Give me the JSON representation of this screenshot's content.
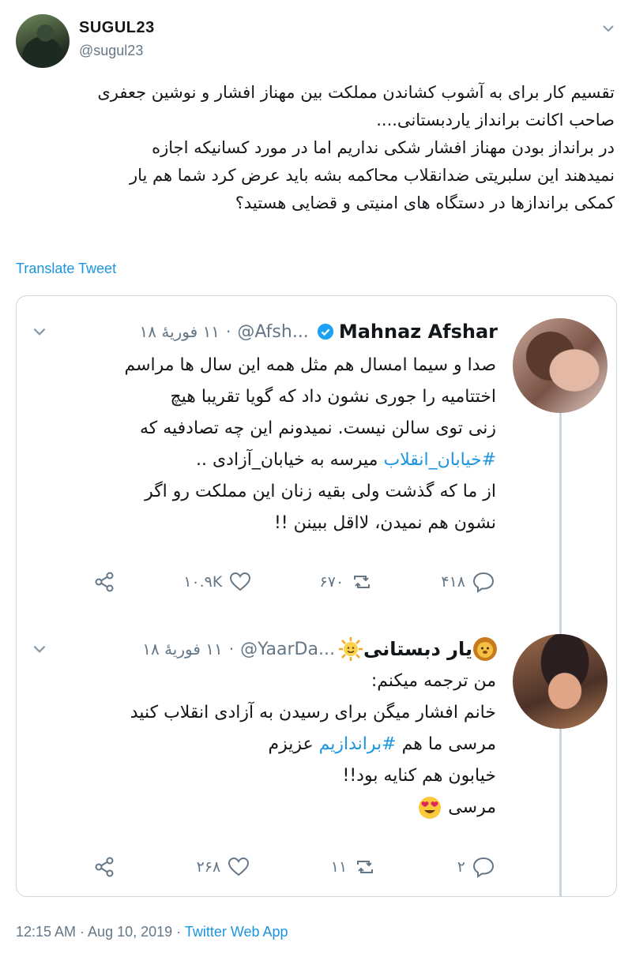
{
  "tweet": {
    "author_name": "SUGUL23",
    "author_handle": "@sugul23",
    "lines": [
      "تقسیم کار برای به آشوب کشاندن مملکت بین مهناز افشار و نوشین جعفری",
      "صاحب اکانت برانداز یاردبستانی....",
      "در برانداز بودن مهناز افشار شکی نداریم اما در مورد کسانیکه اجازه",
      "نمیدهند این سلبریتی ضدانقلاب محاکمه بشه باید عرض کرد شما هم یار",
      "کمکی براندازها در دستگاه های امنیتی و قضایی هستید؟"
    ],
    "translate_label": "Translate Tweet",
    "timestamp": "12:15 AM · Aug 10, 2019 ·",
    "source": "Twitter Web App"
  },
  "quoted": [
    {
      "name": "Mahnaz Afshar",
      "verified": true,
      "handle": "@Afsh...",
      "date": "۱۱ فوریهٔ ۱۸",
      "lines": [
        {
          "text": "صدا و سیما امسال هم مثل همه این سال ها مراسم"
        },
        {
          "text": "اختتامیه را جوری نشون داد که گویا تقریبا هیچ"
        },
        {
          "text": "زنی توی سالن نیست. نمیدونم این چه تصادفیه که"
        },
        {
          "hashtag": "#خیابان_انقلاب",
          "text": " میرسه به خیابان_آزادی .."
        },
        {
          "text": "از ما که گذشت ولی  بقیه زنان این مملکت رو اگر"
        },
        {
          "text": "نشون هم نمیدن، لااقل ببینن !!"
        }
      ],
      "replies": "۴۱۸",
      "retweets": "۶۷۰",
      "likes": "۱۰.۹K"
    },
    {
      "name": "یار دبستانی",
      "handle": "@YaarDa...",
      "date": "۱۱ فوریهٔ ۱۸",
      "lines": [
        {
          "text": "من ترجمه میکنم:"
        },
        {
          "text": "خانم افشار میگن برای رسیدن به آزادی انقلاب کنید"
        },
        {
          "text": "مرسی ما هم ",
          "hashtag": "#براندازیم",
          "text2": " عزیزم"
        },
        {
          "text": "خیابون هم کنایه بود!!"
        },
        {
          "text": "مرسی "
        }
      ],
      "replies": "۲",
      "retweets": "۱۱",
      "likes": "۲۶۸"
    }
  ],
  "icons": {
    "caret": "chevron-down-icon",
    "verified": "verified-badge-icon",
    "reply": "reply-icon",
    "retweet": "retweet-icon",
    "like": "heart-icon",
    "share": "share-icon",
    "sun_emoji": "smiling-sun-emoji",
    "lion_emoji": "lion-face-emoji",
    "heart_eyes_emoji": "heart-eyes-emoji"
  },
  "colors": {
    "link": "#1b95e0",
    "muted": "#657786",
    "text": "#14171a",
    "border": "#ccd6dd"
  }
}
